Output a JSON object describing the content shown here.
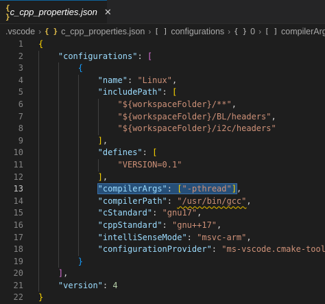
{
  "tab": {
    "icon_text": "{ }",
    "title": "c_cpp_properties.json",
    "close_label": "✕"
  },
  "breadcrumb": [
    {
      "icon": "",
      "label": ".vscode"
    },
    {
      "icon": "{ }",
      "label": "c_cpp_properties.json"
    },
    {
      "icon": "[ ]",
      "label": "configurations"
    },
    {
      "icon": "{ }",
      "label": "0"
    },
    {
      "icon": "[ ]",
      "label": "compilerArgs"
    }
  ],
  "active_line": 13,
  "lines": [
    {
      "n": 1,
      "indent": 0,
      "tokens": [
        [
          "b1",
          "{"
        ]
      ]
    },
    {
      "n": 2,
      "indent": 1,
      "tokens": [
        [
          "k",
          "\"configurations\""
        ],
        [
          "p",
          ": "
        ],
        [
          "b2",
          "["
        ]
      ]
    },
    {
      "n": 3,
      "indent": 2,
      "tokens": [
        [
          "b3",
          "{"
        ]
      ]
    },
    {
      "n": 4,
      "indent": 3,
      "tokens": [
        [
          "k",
          "\"name\""
        ],
        [
          "p",
          ": "
        ],
        [
          "s",
          "\"Linux\""
        ],
        [
          "p",
          ","
        ]
      ]
    },
    {
      "n": 5,
      "indent": 3,
      "tokens": [
        [
          "k",
          "\"includePath\""
        ],
        [
          "p",
          ": "
        ],
        [
          "b1",
          "["
        ]
      ]
    },
    {
      "n": 6,
      "indent": 4,
      "tokens": [
        [
          "s",
          "\"${workspaceFolder}/**\""
        ],
        [
          "p",
          ","
        ]
      ]
    },
    {
      "n": 7,
      "indent": 4,
      "tokens": [
        [
          "s",
          "\"${workspaceFolder}/BL/headers\""
        ],
        [
          "p",
          ","
        ]
      ]
    },
    {
      "n": 8,
      "indent": 4,
      "tokens": [
        [
          "s",
          "\"${workspaceFolder}/i2c/headers\""
        ]
      ]
    },
    {
      "n": 9,
      "indent": 3,
      "tokens": [
        [
          "b1",
          "]"
        ],
        [
          "p",
          ","
        ]
      ]
    },
    {
      "n": 10,
      "indent": 3,
      "tokens": [
        [
          "k",
          "\"defines\""
        ],
        [
          "p",
          ": "
        ],
        [
          "b1",
          "["
        ]
      ]
    },
    {
      "n": 11,
      "indent": 4,
      "tokens": [
        [
          "s",
          "\"VERSION=0.1\""
        ]
      ]
    },
    {
      "n": 12,
      "indent": 3,
      "tokens": [
        [
          "b1",
          "]"
        ],
        [
          "p",
          ","
        ]
      ]
    },
    {
      "n": 13,
      "indent": 3,
      "tokens": [
        [
          "k",
          "\"compilerArgs\""
        ],
        [
          "p",
          ": "
        ],
        [
          "b1",
          "["
        ],
        [
          "s",
          "\"-pthread\""
        ],
        [
          "b1",
          "]"
        ],
        [
          "p",
          ","
        ]
      ]
    },
    {
      "n": 14,
      "indent": 3,
      "tokens": [
        [
          "k",
          "\"compilerPath\""
        ],
        [
          "p",
          ": "
        ],
        [
          "s",
          "\"/usr/bin/gcc\""
        ],
        [
          "p",
          ","
        ]
      ]
    },
    {
      "n": 15,
      "indent": 3,
      "tokens": [
        [
          "k",
          "\"cStandard\""
        ],
        [
          "p",
          ": "
        ],
        [
          "s",
          "\"gnu17\""
        ],
        [
          "p",
          ","
        ]
      ]
    },
    {
      "n": 16,
      "indent": 3,
      "tokens": [
        [
          "k",
          "\"cppStandard\""
        ],
        [
          "p",
          ": "
        ],
        [
          "s",
          "\"gnu++17\""
        ],
        [
          "p",
          ","
        ]
      ]
    },
    {
      "n": 17,
      "indent": 3,
      "tokens": [
        [
          "k",
          "\"intelliSenseMode\""
        ],
        [
          "p",
          ": "
        ],
        [
          "s",
          "\"msvc-arm\""
        ],
        [
          "p",
          ","
        ]
      ]
    },
    {
      "n": 18,
      "indent": 3,
      "tokens": [
        [
          "k",
          "\"configurationProvider\""
        ],
        [
          "p",
          ": "
        ],
        [
          "s",
          "\"ms-vscode.cmake-tools\""
        ]
      ]
    },
    {
      "n": 19,
      "indent": 2,
      "tokens": [
        [
          "b3",
          "}"
        ]
      ]
    },
    {
      "n": 20,
      "indent": 1,
      "tokens": [
        [
          "b2",
          "]"
        ],
        [
          "p",
          ","
        ]
      ]
    },
    {
      "n": 21,
      "indent": 1,
      "tokens": [
        [
          "k",
          "\"version\""
        ],
        [
          "p",
          ": "
        ],
        [
          "n",
          "4"
        ]
      ]
    },
    {
      "n": 22,
      "indent": 0,
      "tokens": [
        [
          "b1",
          "}"
        ]
      ]
    }
  ]
}
